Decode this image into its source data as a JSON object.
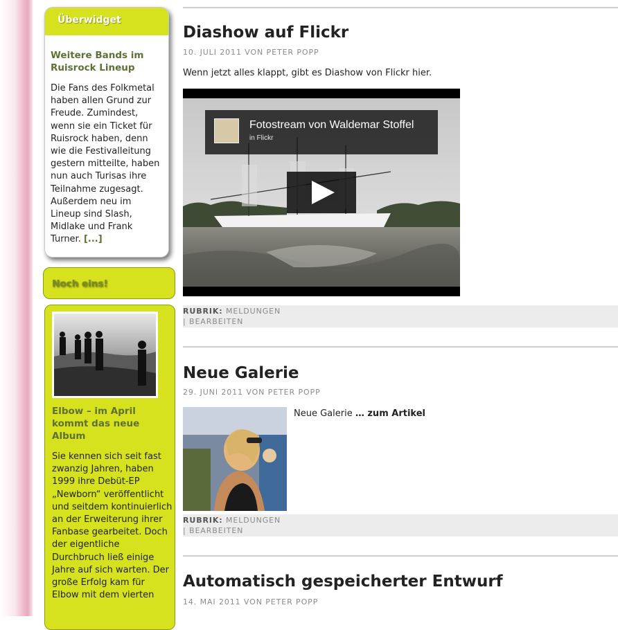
{
  "sidebar": {
    "widget1": {
      "header": "Überwidget",
      "title": "Weitere Bands im Ruisrock Lineup",
      "text": "Die Fans des Folkmetal haben allen Grund zur Freude. Zumindest, wenn sie ein Ticket für Ruisrock haben, denn wie die Festivalleitung gestern mitteilte, haben nun auch Turisas ihre Teilnahme zugesagt. Außerdem neu im Lineup sind Slash, Midlake und Frank Turner.",
      "more": "[...]"
    },
    "widget2": {
      "header": "Noch eins!",
      "title": "Elbow – im April kommt das neue Album",
      "text": "Sie kennen sich seit fast zwanzig Jahren, haben 1999 ihre Debüt-EP „Newborn“ veröffentlicht und seitdem kontinuierlich an der Erweiterung ihrer Fanbase gearbeitet. Doch der eigentliche Durchbruch ließ einige Jahre auf sich warten. Der große Erfolg kam für Elbow mit dem vierten"
    }
  },
  "posts": [
    {
      "title": "Diashow auf Flickr",
      "meta": "10. JULI 2011 VON PETER POPP",
      "text": "Wenn jetzt alles klappt, gibt es Diashow von Flickr hier.",
      "video": {
        "title": "Fotostream von Waldemar Stoffel",
        "subtitle": "in Flickr"
      },
      "rubrik_label": "RUBRIK:",
      "rubrik": "MELDUNGEN",
      "edit": "| BEARBEITEN"
    },
    {
      "title": "Neue Galerie",
      "meta": "29. JUNI 2011 VON PETER POPP",
      "text": "Neue Galerie",
      "more": "… zum Artikel",
      "rubrik_label": "RUBRIK:",
      "rubrik": "MELDUNGEN",
      "edit": "| BEARBEITEN"
    },
    {
      "title": "Automatisch gespeicherter Entwurf",
      "meta": "14. MAI 2011 VON PETER POPP"
    }
  ],
  "colors": {
    "accent": "#d6e21d",
    "link_green": "#5e7034",
    "meta_gray": "#8a8a8a"
  },
  "icons": {
    "play": "play-icon"
  }
}
